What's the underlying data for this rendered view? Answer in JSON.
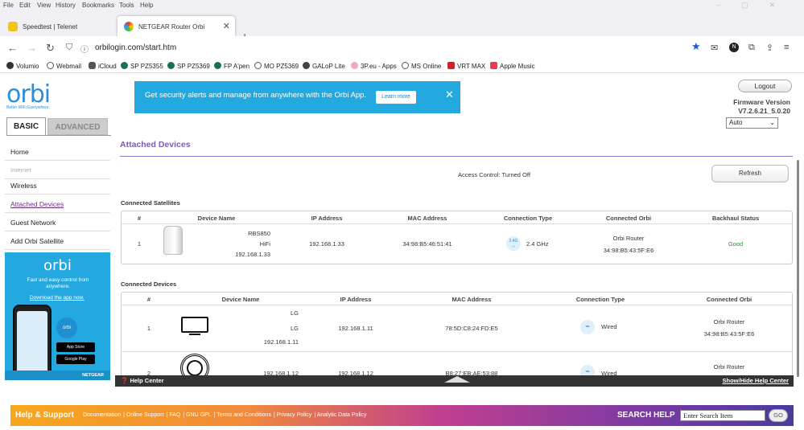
{
  "browser": {
    "menu": [
      "File",
      "Edit",
      "View",
      "History",
      "Bookmarks",
      "Tools",
      "Help"
    ],
    "tabs": [
      {
        "title": "Speedtest | Telenet"
      },
      {
        "title": "NETGEAR Router Orbi"
      }
    ],
    "url": "orbilogin.com/start.htm",
    "bookmarks": [
      "Volumio",
      "Webmail",
      "iCloud",
      "SP PZ5355",
      "SP PZ5369",
      "FP A'pen",
      "MO PZ5369",
      "GALoP Lite",
      "3P.eu - Apps",
      "MS Online",
      "VRT MAX",
      "Apple Music"
    ]
  },
  "header": {
    "logo": "orbi",
    "tagline": "Better WiFi Everywhere.",
    "banner_text": "Get security alerts and manage from anywhere with the Orbi App.",
    "banner_button": "Learn more",
    "logout": "Logout",
    "firmware_label": "Firmware Version",
    "firmware_version": "V7.2.6.21_5.0.20",
    "language": "Auto",
    "tab_basic": "BASIC",
    "tab_advanced": "ADVANCED"
  },
  "sidebar": {
    "items": [
      "Home",
      "Internet",
      "Wireless",
      "Attached Devices",
      "Guest Network",
      "Add Orbi Satellite"
    ],
    "promo": {
      "logo": "orbi",
      "text": "Fast and easy control from anywhere.",
      "link": "Download the app now.",
      "app_store": "App Store",
      "google_play": "Google Play",
      "brand": "NETGEAR"
    }
  },
  "main": {
    "title": "Attached Devices",
    "access_control": "Access Control: Turned Off",
    "refresh": "Refresh",
    "satellites": {
      "title": "Connected Satellites",
      "headers": [
        "#",
        "Device Name",
        "IP Address",
        "MAC Address",
        "Connection Type",
        "Connected Orbi",
        "Backhaul Status"
      ],
      "rows": [
        {
          "num": "1",
          "name1": "RBS850",
          "name2": "HiFi",
          "name3": "192.168.1.33",
          "ip": "192.168.1.33",
          "mac": "34:98:B5:46:51:41",
          "band": "2.4G",
          "conn": "2.4 GHz",
          "orbi1": "Orbi Router",
          "orbi2": "34:98:B5:43:5F:E6",
          "status": "Good"
        }
      ]
    },
    "devices": {
      "title": "Connected Devices",
      "headers": [
        "#",
        "Device Name",
        "IP Address",
        "MAC Address",
        "Connection Type",
        "Connected Orbi"
      ],
      "rows": [
        {
          "num": "1",
          "name1": "LG",
          "name2": "LG",
          "name3": "192.168.1.11",
          "ip": "192.168.1.11",
          "mac": "78:5D:C8:24:FD:E5",
          "conn": "Wired",
          "orbi1": "Orbi Router",
          "orbi2": "34:98:B5:43:5F:E6"
        },
        {
          "num": "2",
          "name3": "192.168.1.12",
          "ip": "192.168.1.12",
          "mac": "B8:27:EB:AE:53:88",
          "conn": "Wired",
          "orbi1": "Orbi Router"
        }
      ]
    },
    "help_center": "Help Center",
    "show_hide_help": "Show/Hide Help Center"
  },
  "footer": {
    "title": "Help & Support",
    "links": [
      "Documentation",
      "Online Support",
      "FAQ",
      "GNU GPL",
      "Terms and Conditions",
      "Privacy Policy",
      "Analytic Data Policy"
    ],
    "search_label": "SEARCH HELP",
    "search_value": "Enter Search Item",
    "go": "GO"
  }
}
